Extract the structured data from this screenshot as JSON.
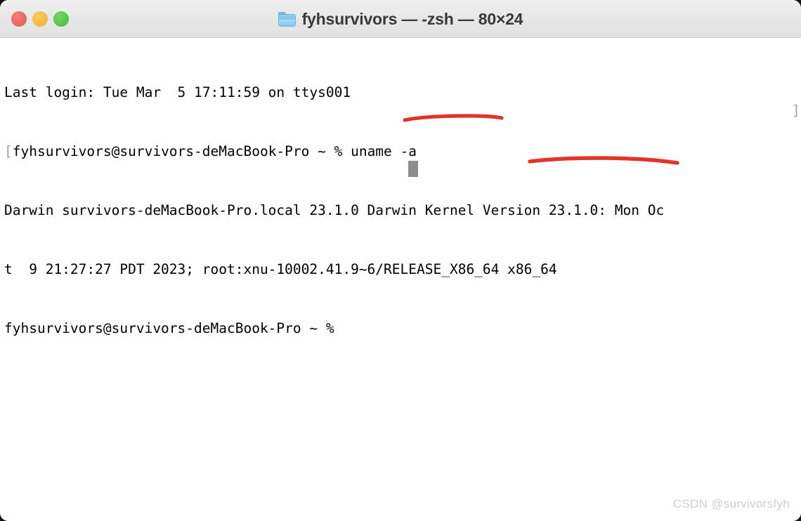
{
  "window": {
    "title": "fyhsurvivors — -zsh — 80×24",
    "folder_icon": "folder-icon",
    "controls": {
      "close_label": "close",
      "minimize_label": "minimize",
      "zoom_label": "zoom",
      "close_color": "#e9695f",
      "minimize_color": "#f5bc40",
      "zoom_color": "#56c848"
    },
    "titlebar_bg": "#e8e8e8",
    "body_bg": "#ffffff"
  },
  "terminal": {
    "columns": 80,
    "rows": 24,
    "shell": "-zsh",
    "foreground": "#000000",
    "bracket_color": "#a0a0a0",
    "cursor_color": "#8c8c8c",
    "lines": [
      "Last login: Tue Mar  5 17:11:59 on ttys001",
      "fyhsurvivors@survivors-deMacBook-Pro ~ % uname -a",
      "Darwin survivors-deMacBook-Pro.local 23.1.0 Darwin Kernel Version 23.1.0: Mon Oc",
      "t  9 21:27:27 PDT 2023; root:xnu-10002.41.9~6/RELEASE_X86_64 x86_64",
      "fyhsurvivors@survivors-deMacBook-Pro ~ % "
    ],
    "line_prefix_bracket": "[",
    "line_suffix_bracket": "]",
    "prompt_user": "fyhsurvivors",
    "prompt_host": "survivors-deMacBook-Pro",
    "prompt_cwd": "~",
    "prompt_symbol": "%",
    "command": "uname -a",
    "kernel_name": "Darwin",
    "kernel_hostname": "survivors-deMacBook-Pro.local",
    "kernel_release": "23.1.0",
    "kernel_version": "Darwin Kernel Version 23.1.0: Mon Oct  9 21:27:27 PDT 2023; root:xnu-10002.41.9~6/RELEASE_X86_64",
    "machine_arch": "x86_64",
    "last_login_day": "Tue Mar  5",
    "last_login_time": "17:11:59",
    "last_login_tty": "ttys001"
  },
  "annotations": {
    "color": "#e3342a",
    "items": [
      {
        "label": "underline-command",
        "target": "uname -a"
      },
      {
        "label": "underline-architecture",
        "target": "RELEASE_X86_64 x86_64"
      }
    ]
  },
  "watermark": {
    "text": "CSDN @survivorsfyh",
    "color": "#cfcfcf"
  }
}
